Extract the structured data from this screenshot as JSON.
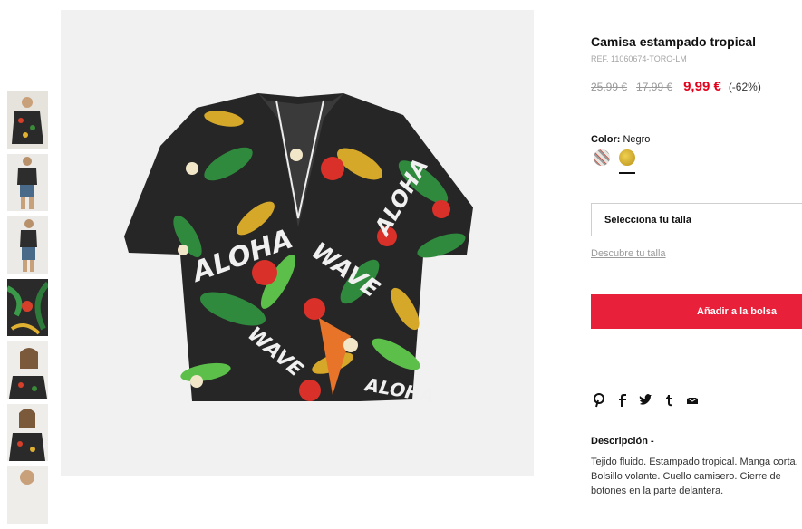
{
  "product": {
    "title": "Camisa estampado tropical",
    "ref": "REF. 11060674-TORO-LM",
    "price_original": "25,99 €",
    "price_previous": "17,99 €",
    "price_current": "9,99 €",
    "discount": "(-62%)"
  },
  "color": {
    "label": "Color:",
    "value": "Negro",
    "swatches": [
      {
        "name": "white-pattern",
        "color": "#e8e4e0"
      },
      {
        "name": "black-tropical",
        "color": "#c9a32a",
        "selected": true
      }
    ]
  },
  "size": {
    "select_label": "Selecciona tu talla",
    "guide_link": "Descubre tu talla"
  },
  "cart": {
    "add_label": "Añadir a la bolsa"
  },
  "share": {
    "icons": [
      "pinterest-icon",
      "facebook-icon",
      "twitter-icon",
      "tumblr-icon",
      "mail-icon"
    ]
  },
  "description": {
    "title": "Descripción -",
    "text": "Tejido fluido. Estampado tropical. Manga corta. Bolsillo volante. Cuello camisero. Cierre de botones en la parte delantera."
  },
  "colors": {
    "accent": "#e8203a",
    "sale": "#e4001b"
  }
}
